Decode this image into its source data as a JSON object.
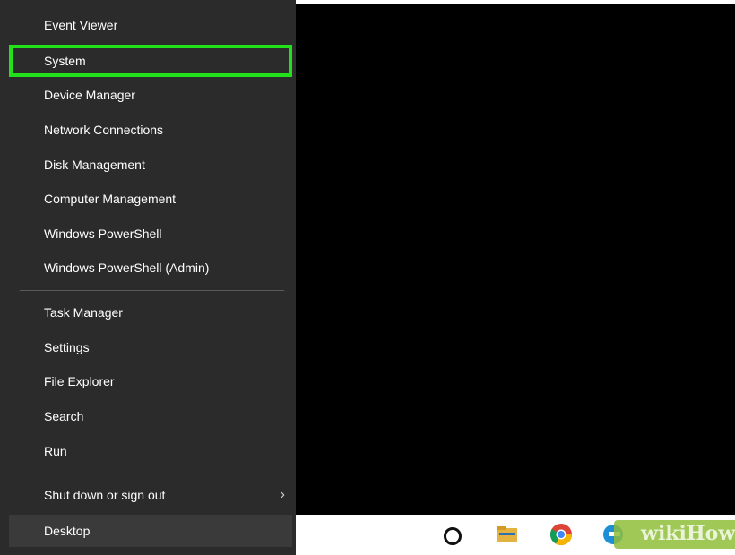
{
  "menu": {
    "items": [
      {
        "label": "Event Viewer"
      },
      {
        "label": "System"
      },
      {
        "label": "Device Manager"
      },
      {
        "label": "Network Connections"
      },
      {
        "label": "Disk Management"
      },
      {
        "label": "Computer Management"
      },
      {
        "label": "Windows PowerShell"
      },
      {
        "label": "Windows PowerShell (Admin)"
      },
      {
        "label": "Task Manager"
      },
      {
        "label": "Settings"
      },
      {
        "label": "File Explorer"
      },
      {
        "label": "Search"
      },
      {
        "label": "Run"
      },
      {
        "label": "Shut down or sign out"
      },
      {
        "label": "Desktop"
      }
    ],
    "highlight_color": "#22e01a"
  },
  "taskbar": {
    "icons": [
      "cortana-icon",
      "file-explorer-icon",
      "chrome-icon",
      "edge-icon"
    ]
  },
  "watermark": {
    "text": "wikiHow"
  }
}
